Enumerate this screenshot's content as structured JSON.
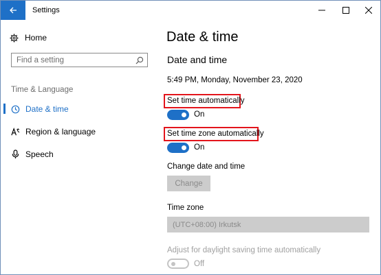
{
  "window": {
    "title": "Settings"
  },
  "sidebar": {
    "home_label": "Home",
    "search_placeholder": "Find a setting",
    "section_label": "Time & Language",
    "items": [
      {
        "label": "Date & time",
        "icon": "clock-icon",
        "active": true
      },
      {
        "label": "Region & language",
        "icon": "language-icon",
        "active": false
      },
      {
        "label": "Speech",
        "icon": "microphone-icon",
        "active": false
      }
    ]
  },
  "main": {
    "page_title": "Date & time",
    "section_title": "Date and time",
    "current_time": "5:49 PM, Monday, November 23, 2020",
    "set_time_auto": {
      "label": "Set time automatically",
      "state": "On",
      "on": true
    },
    "set_timezone_auto": {
      "label": "Set time zone automatically",
      "state": "On",
      "on": true
    },
    "change_date_time": {
      "label": "Change date and time",
      "button": "Change"
    },
    "time_zone": {
      "label": "Time zone",
      "value": "(UTC+08:00) Irkutsk"
    },
    "daylight_saving": {
      "label": "Adjust for daylight saving time automatically",
      "state": "Off",
      "on": false
    }
  },
  "colors": {
    "accent": "#1e70c7",
    "highlight_box": "#e3141b",
    "disabled_fill": "#cccccc",
    "disabled_text": "#a0a0a0"
  }
}
